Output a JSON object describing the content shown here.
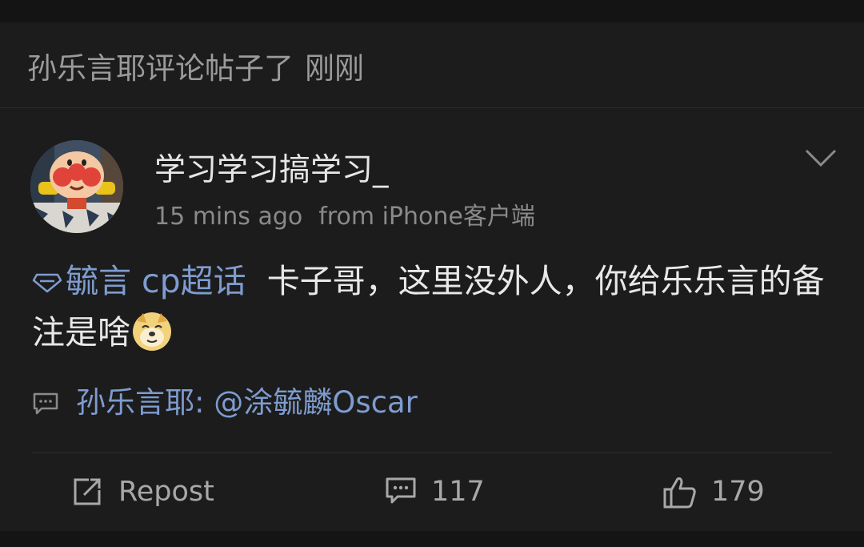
{
  "notice": {
    "text": "孙乐言耶评论帖子了",
    "time": "刚刚"
  },
  "post": {
    "author": "学习学习搞学习_",
    "time_ago": "15 mins ago",
    "source": "from iPhone客户端",
    "topic_tag": "毓言 cp超话",
    "body_text": "卡子哥，这里没外人，你给乐乐言的备注是啥",
    "emoji": "doge"
  },
  "reply": {
    "author_prefix": "孙乐言耶:",
    "mention": "@涂毓麟Oscar"
  },
  "actions": {
    "repost_label": "Repost",
    "comment_count": "117",
    "like_count": "179"
  },
  "colors": {
    "background": "#1c1c1c",
    "link": "#7e9ccf",
    "primary_text": "#e8e8e8",
    "secondary_text": "#8a8a8a"
  },
  "icons": {
    "chevron": "chevron-down-icon",
    "topic": "diamond-icon",
    "reply": "comment-icon",
    "repost": "repost-icon",
    "comment": "comment-icon",
    "like": "thumbs-up-icon"
  }
}
